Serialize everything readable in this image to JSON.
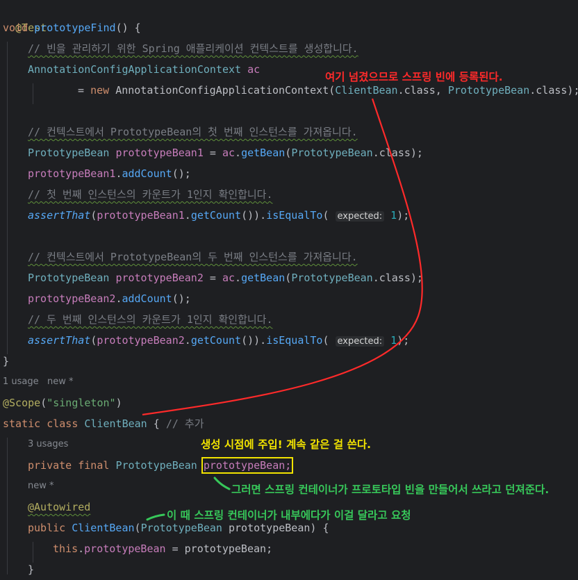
{
  "code": {
    "annotation_test": "@Test",
    "kw_void": "void",
    "method_name": "prototypeFind",
    "paren_brace": "() {",
    "comment1": "// 빈을 관리하기 위한 Spring 애플리케이션 컨텍스트를 생성합니다.",
    "type_ctx": "AnnotationConfigApplicationContext",
    "var_ac": "ac",
    "eq": "= ",
    "kw_new": "new",
    "ctor_ctx": "AnnotationConfigApplicationContext",
    "open_paren": "(",
    "client_bean": "ClientBean",
    "dot_class_comma": ".class, ",
    "prototype_bean": "PrototypeBean",
    "dot_class_close": ".class);",
    "comment2": "// 컨텍스트에서 PrototypeBean의 첫 번째 인스턴스를 가져옵니다.",
    "var_pb1": "prototypeBean1",
    "eq_ac": " = ",
    "ac_get": "ac",
    "get_bean": "getBean",
    "dot": ".",
    "semi": ";",
    "add_count": "addCount",
    "call_end": "();",
    "comment3": "// 첫 번째 인스턴스의 카운트가 1인지 확인합니다.",
    "assert_that": "assertThat",
    "get_count": "getCount",
    "assert_mid": "()).",
    "is_equal_to": "isEqualTo",
    "hint_expected": "expected:",
    "num_one": "1",
    "close_stmt": ");",
    "comment4": "// 컨텍스트에서 PrototypeBean의 두 번째 인스턴스를 가져옵니다.",
    "var_pb2": "prototypeBean2",
    "comment5": "// 두 번째 인스턴스의 카운트가 1인지 확인합니다.",
    "close_brace": "}",
    "usage_1": "1 usage",
    "new_star": "new *",
    "annotation_scope": "@Scope",
    "scope_value": "\"singleton\"",
    "close_paren": ")",
    "kw_static": "static",
    "kw_class": "class",
    "class_name": "ClientBean",
    "brace_open": " {",
    "comment_add": "// 추가",
    "usage_3": "3 usages",
    "kw_private": "private",
    "kw_final": "final",
    "field_name": "prototypeBean;",
    "annotation_autowired": "@Autowired",
    "kw_public": "public",
    "param_name": "prototypeBean",
    "paren_close_brace": ") {",
    "kw_this": "this",
    "field_ref": "prototypeBean",
    "assign_param": "prototypeBean"
  },
  "annotations": {
    "red_note": "여기 넘겼으므로 스프링 빈에 등록된다.",
    "yellow_note": "생성 시점에 주입! 계속 같은 걸 쓴다.",
    "green_note1": "그러면 스프링 컨테이너가 프로토타입 빈을 만들어서 쓰라고 던져준다.",
    "green_note2": "이 때 스프링 컨테이너가 내부에다가 이걸 달라고 요청"
  },
  "colors": {
    "background": "#1e1f22",
    "red_note": "#ff2a2a",
    "yellow_note": "#f2e300",
    "green_note": "#37c75a"
  }
}
